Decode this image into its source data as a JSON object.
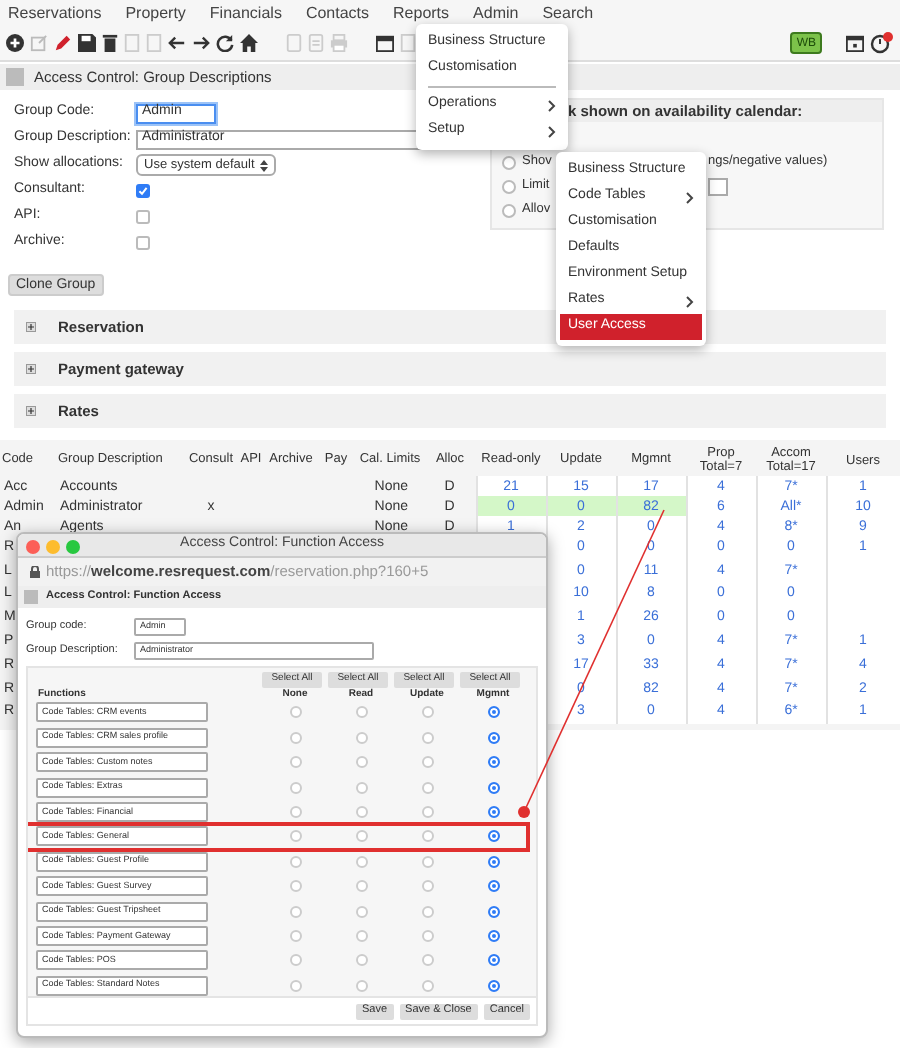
{
  "menu_bar": [
    "Reservations",
    "Property",
    "Financials",
    "Contacts",
    "Reports",
    "Admin",
    "Search"
  ],
  "toolbar": {
    "badge": "WB"
  },
  "page_title": "Access Control: Group Descriptions",
  "form": {
    "fields": [
      {
        "label": "Group Code:",
        "kind": "text",
        "value": "Admin",
        "focused": true
      },
      {
        "label": "Group Description:",
        "kind": "text",
        "value": "Administrator",
        "focused": false
      },
      {
        "label": "Show allocations:",
        "kind": "select",
        "value": "Use system default"
      },
      {
        "label": "Consultant:",
        "kind": "checkbox",
        "checked": true
      },
      {
        "label": "API:",
        "kind": "checkbox",
        "checked": false
      },
      {
        "label": "Archive:",
        "kind": "checkbox",
        "checked": false
      }
    ]
  },
  "calendar_panel": {
    "heading": "k shown on availability calendar:",
    "options": [
      {
        "kind": "text",
        "texts": [
          "Shov",
          "ngs/negative values)"
        ],
        "checked": false
      },
      {
        "kind": "input",
        "texts": [
          "Limit"
        ],
        "checked": false
      },
      {
        "kind": "text",
        "texts": [
          "Allov"
        ],
        "checked": false
      }
    ]
  },
  "clone_button": "Clone Group",
  "sections": [
    {
      "label": "Reservation",
      "expanded": false
    },
    {
      "label": "Payment gateway",
      "expanded": false
    },
    {
      "label": "Rates",
      "expanded": false
    }
  ],
  "table": {
    "columns": [
      "Code",
      "Group Description",
      "Consult",
      "API",
      "Archive",
      "Pay",
      "Cal. Limits",
      "Alloc",
      "Read-only",
      "Update",
      "Mgmnt",
      "Prop Total=7",
      "Accom Total=17",
      "Users"
    ],
    "rows": [
      {
        "selected": false,
        "cells": [
          "Acc",
          "Accounts",
          null,
          null,
          null,
          null,
          "None",
          "D",
          "21",
          "15",
          "17",
          "4",
          "7*",
          "1"
        ]
      },
      {
        "selected": true,
        "cells": [
          "Admin",
          "Administrator",
          "x",
          null,
          null,
          null,
          "None",
          "D",
          "0",
          "0",
          "82",
          "6",
          "All*",
          "10"
        ]
      },
      {
        "selected": false,
        "cells": [
          "An",
          "Agents",
          null,
          null,
          null,
          null,
          "None",
          "D",
          "1",
          "2",
          "0",
          "4",
          "8*",
          "9"
        ]
      },
      {
        "selected": false,
        "cells": [
          "R",
          null,
          null,
          null,
          null,
          null,
          null,
          null,
          null,
          "0",
          "0",
          "0",
          "0",
          "1"
        ]
      },
      {
        "selected": false,
        "cells": [
          "L",
          null,
          null,
          null,
          null,
          null,
          null,
          null,
          null,
          "0",
          "11",
          "4",
          "7*",
          null
        ]
      },
      {
        "selected": false,
        "cells": [
          "L",
          null,
          null,
          null,
          null,
          null,
          null,
          null,
          null,
          "10",
          "8",
          "0",
          "0",
          null
        ]
      },
      {
        "selected": false,
        "cells": [
          "M",
          null,
          null,
          null,
          null,
          null,
          null,
          null,
          null,
          "1",
          "26",
          "0",
          "0",
          null
        ]
      },
      {
        "selected": false,
        "cells": [
          "P",
          null,
          null,
          null,
          null,
          null,
          null,
          null,
          null,
          "3",
          "0",
          "4",
          "7*",
          "1"
        ]
      },
      {
        "selected": false,
        "cells": [
          "R",
          null,
          null,
          null,
          null,
          null,
          null,
          null,
          null,
          "17",
          "33",
          "4",
          "7*",
          "4"
        ]
      },
      {
        "selected": false,
        "cells": [
          "R",
          null,
          null,
          null,
          null,
          null,
          null,
          null,
          null,
          "0",
          "82",
          "4",
          "7*",
          "2"
        ]
      },
      {
        "selected": false,
        "cells": [
          "R",
          null,
          null,
          null,
          null,
          null,
          null,
          null,
          null,
          "3",
          "0",
          "4",
          "6*",
          "1"
        ]
      }
    ]
  },
  "popup": {
    "title": "Access Control: Function Access",
    "url": "https://**welcome.resrequest.com**/reservation.php?160+5",
    "page_title": "Access Control: Function Access",
    "fields": [
      {
        "label": "Group code:",
        "value": "Admin"
      },
      {
        "label": "Group Description:",
        "value": "Administrator"
      }
    ],
    "select_all": [
      "Select All",
      "Select All",
      "Select All",
      "Select All"
    ],
    "columns": [
      "Functions",
      "None",
      "Read",
      "Update",
      "Mgmnt"
    ],
    "functions": [
      {
        "label": "Code Tables: CRM events",
        "highlighted": false,
        "radios": [
          {
            "selected": false
          },
          {
            "selected": false
          },
          {
            "selected": false
          },
          {
            "selected": true
          }
        ]
      },
      {
        "label": "Code Tables: CRM sales profile",
        "highlighted": false,
        "radios": [
          {
            "selected": false
          },
          {
            "selected": false
          },
          {
            "selected": false
          },
          {
            "selected": true
          }
        ]
      },
      {
        "label": "Code Tables: Custom notes",
        "highlighted": false,
        "radios": [
          {
            "selected": false
          },
          {
            "selected": false
          },
          {
            "selected": false
          },
          {
            "selected": true
          }
        ]
      },
      {
        "label": "Code Tables: Extras",
        "highlighted": false,
        "radios": [
          {
            "selected": false
          },
          {
            "selected": false
          },
          {
            "selected": false
          },
          {
            "selected": true
          }
        ]
      },
      {
        "label": "Code Tables: Financial",
        "highlighted": false,
        "radios": [
          {
            "selected": false
          },
          {
            "selected": false
          },
          {
            "selected": false
          },
          {
            "selected": true
          }
        ]
      },
      {
        "label": "Code Tables: General",
        "highlighted": true,
        "radios": [
          {
            "selected": false
          },
          {
            "selected": false
          },
          {
            "selected": false
          },
          {
            "selected": true
          }
        ]
      },
      {
        "label": "Code Tables: Guest Profile",
        "highlighted": false,
        "radios": [
          {
            "selected": false
          },
          {
            "selected": false
          },
          {
            "selected": false
          },
          {
            "selected": true
          }
        ]
      },
      {
        "label": "Code Tables: Guest Survey",
        "highlighted": false,
        "radios": [
          {
            "selected": false
          },
          {
            "selected": false
          },
          {
            "selected": false
          },
          {
            "selected": true
          }
        ]
      },
      {
        "label": "Code Tables: Guest Tripsheet",
        "highlighted": false,
        "radios": [
          {
            "selected": false
          },
          {
            "selected": false
          },
          {
            "selected": false
          },
          {
            "selected": true
          }
        ]
      },
      {
        "label": "Code Tables: Payment Gateway",
        "highlighted": false,
        "radios": [
          {
            "selected": false
          },
          {
            "selected": false
          },
          {
            "selected": false
          },
          {
            "selected": true
          }
        ]
      },
      {
        "label": "Code Tables: POS",
        "highlighted": false,
        "radios": [
          {
            "selected": false
          },
          {
            "selected": false
          },
          {
            "selected": false
          },
          {
            "selected": true
          }
        ]
      },
      {
        "label": "Code Tables: Standard Notes",
        "highlighted": false,
        "radios": [
          {
            "selected": false
          },
          {
            "selected": false
          },
          {
            "selected": false
          },
          {
            "selected": true
          }
        ]
      }
    ],
    "buttons": [
      "Save",
      "Save & Close",
      "Cancel"
    ]
  },
  "admin_menu": {
    "items": [
      {
        "kind": "item",
        "label": "Business Structure"
      },
      {
        "kind": "item",
        "label": "Customisation"
      },
      {
        "kind": "divider"
      },
      {
        "kind": "submenu",
        "label": "Operations"
      },
      {
        "kind": "submenu",
        "label": "Setup"
      }
    ]
  },
  "setup_menu": {
    "items": [
      {
        "kind": "item",
        "label": "Business Structure",
        "selected": false
      },
      {
        "kind": "submenu",
        "label": "Code Tables",
        "selected": false
      },
      {
        "kind": "item",
        "label": "Customisation",
        "selected": false
      },
      {
        "kind": "item",
        "label": "Defaults",
        "selected": false
      },
      {
        "kind": "item",
        "label": "Environment Setup",
        "selected": false
      },
      {
        "kind": "submenu",
        "label": "Rates",
        "selected": false
      },
      {
        "kind": "item",
        "label": "User Access",
        "selected": true
      }
    ]
  }
}
